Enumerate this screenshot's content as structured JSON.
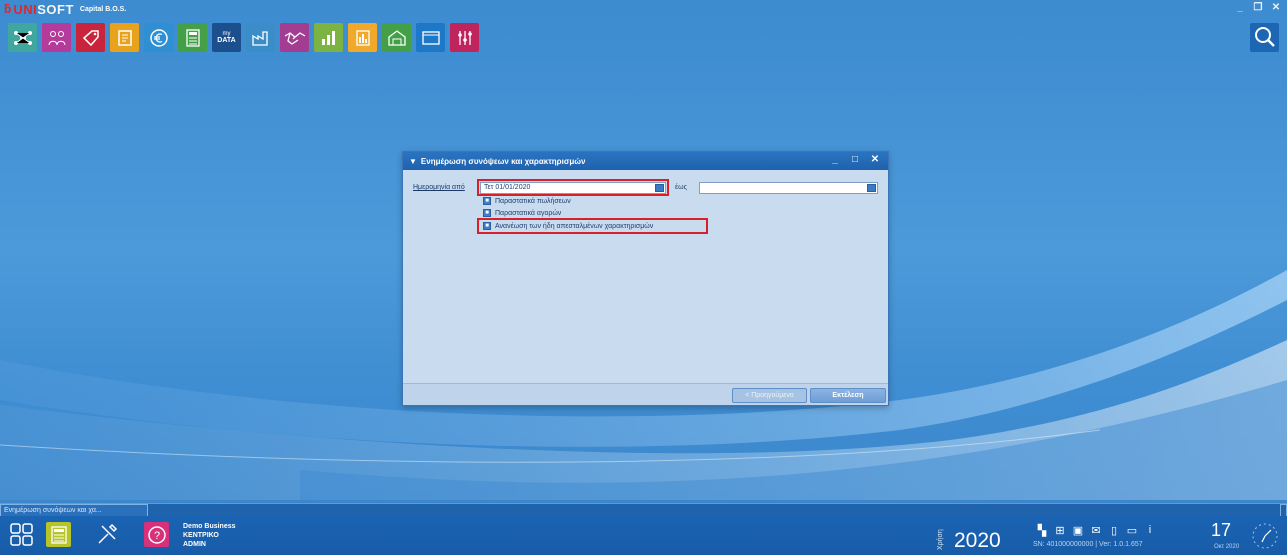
{
  "app": {
    "logo_mark": "ƃ",
    "logo_uni": "UNI",
    "logo_soft": "SOFT",
    "logo_subtitle": "Capital B.O.S.",
    "window_controls": [
      "_",
      "❐",
      "✕"
    ]
  },
  "toolbar": {
    "items": [
      {
        "icon": "network-icon",
        "color": "#3fa7a0"
      },
      {
        "icon": "people-icon",
        "color": "#b43a9b"
      },
      {
        "icon": "tag-icon",
        "color": "#c8243c"
      },
      {
        "icon": "ledger-icon",
        "color": "#e8a21b"
      },
      {
        "icon": "euro-icon",
        "color": "#2f8fd3"
      },
      {
        "icon": "calculator-icon",
        "color": "#43a047"
      },
      {
        "icon": "mydata-icon",
        "color": "#1b4f8e",
        "label_line1": "my",
        "label_line2": "DATA"
      },
      {
        "icon": "factory-icon",
        "color": "#3a8dc7"
      },
      {
        "icon": "handshake-icon",
        "color": "#a23d91"
      },
      {
        "icon": "bar-chart-icon",
        "color": "#7cb342"
      },
      {
        "icon": "report-icon",
        "color": "#f0a92a"
      },
      {
        "icon": "warehouse-icon",
        "color": "#43a047"
      },
      {
        "icon": "window-icon",
        "color": "#1d78c8"
      },
      {
        "icon": "settings-icon",
        "color": "#c0245c"
      }
    ],
    "search_icon": "search-icon"
  },
  "dialog": {
    "title": "Ενημέρωση συνόψεων και χαρακτηρισμών",
    "controls": [
      "_",
      "□",
      "✕"
    ],
    "from_label": "Ημερομηνία από",
    "from_value": "Τετ 01/01/2020",
    "to_label": "έως",
    "to_value": "",
    "checkboxes": [
      {
        "label": "Παραστατικά πωλήσεων",
        "checked": true
      },
      {
        "label": "Παραστατικά αγορών",
        "checked": true
      },
      {
        "label": "Ανανέωση των ήδη απεσταλμένων χαρακτηρισμών",
        "checked": true
      }
    ],
    "prev_button": "< Προηγούμενο",
    "exec_button": "Εκτέλεση",
    "highlight_color": "#d8202a"
  },
  "taskbar": {
    "open_window": "Ενημέρωση συνόψεων και χα...",
    "company_name": "Demo Business",
    "branch": "ΚΕΝΤΡΙΚΟ",
    "user": "ADMIN",
    "fiscal_label": "Χρήση",
    "year": "2020",
    "serial_line": "SN: 401000000000 | Ver: 1.0.1.657",
    "day": "17",
    "month": "Οκτ 2020"
  }
}
